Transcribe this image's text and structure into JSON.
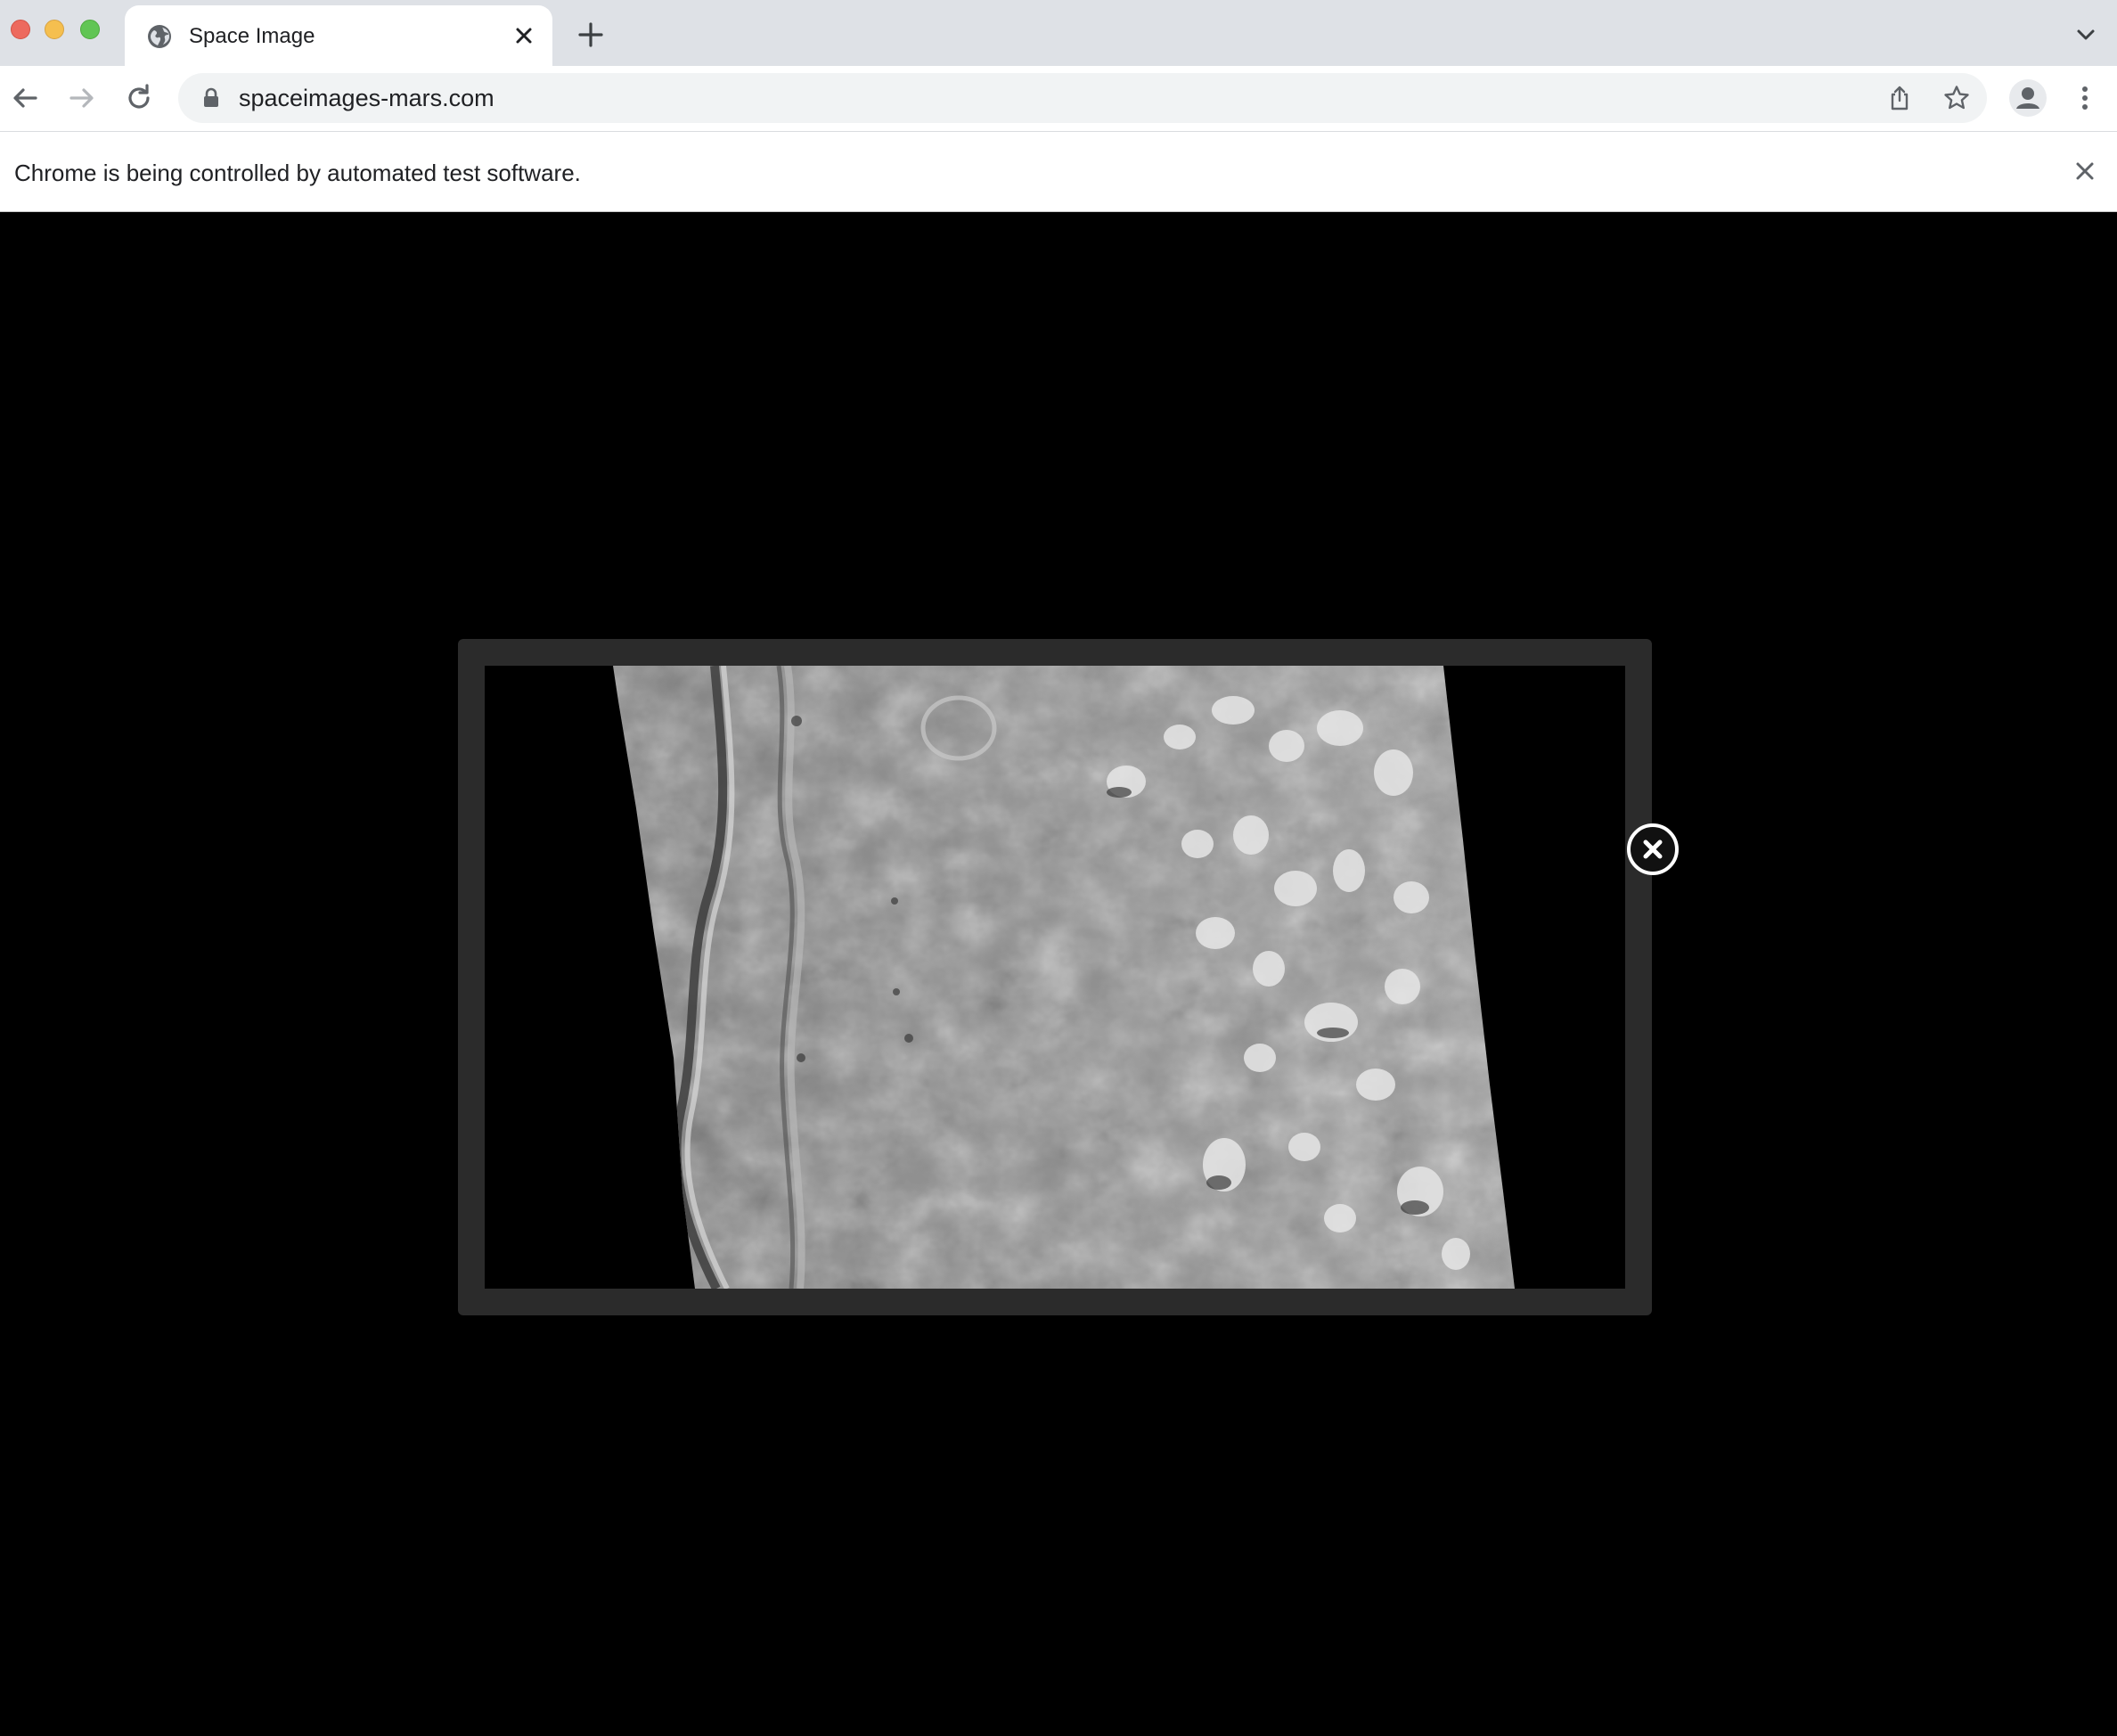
{
  "browser": {
    "tab": {
      "title": "Space Image",
      "favicon": "globe-icon"
    },
    "toolbar": {
      "url": "spaceimages-mars.com",
      "back_icon": "back-arrow-icon",
      "forward_icon": "forward-arrow-icon",
      "reload_icon": "reload-icon",
      "share_icon": "share-icon",
      "bookmark_icon": "star-icon",
      "profile_icon": "profile-icon",
      "menu_icon": "kebab-menu-icon"
    },
    "infobar": {
      "text": "Chrome is being controlled by automated test software."
    }
  },
  "lightbox": {
    "close_icon": "close-icon",
    "image": "mars-surface-image"
  },
  "colors": {
    "tabstrip": "#dee1e6",
    "page_background": "#000000",
    "lightbox_frame": "#2b2b2b"
  }
}
